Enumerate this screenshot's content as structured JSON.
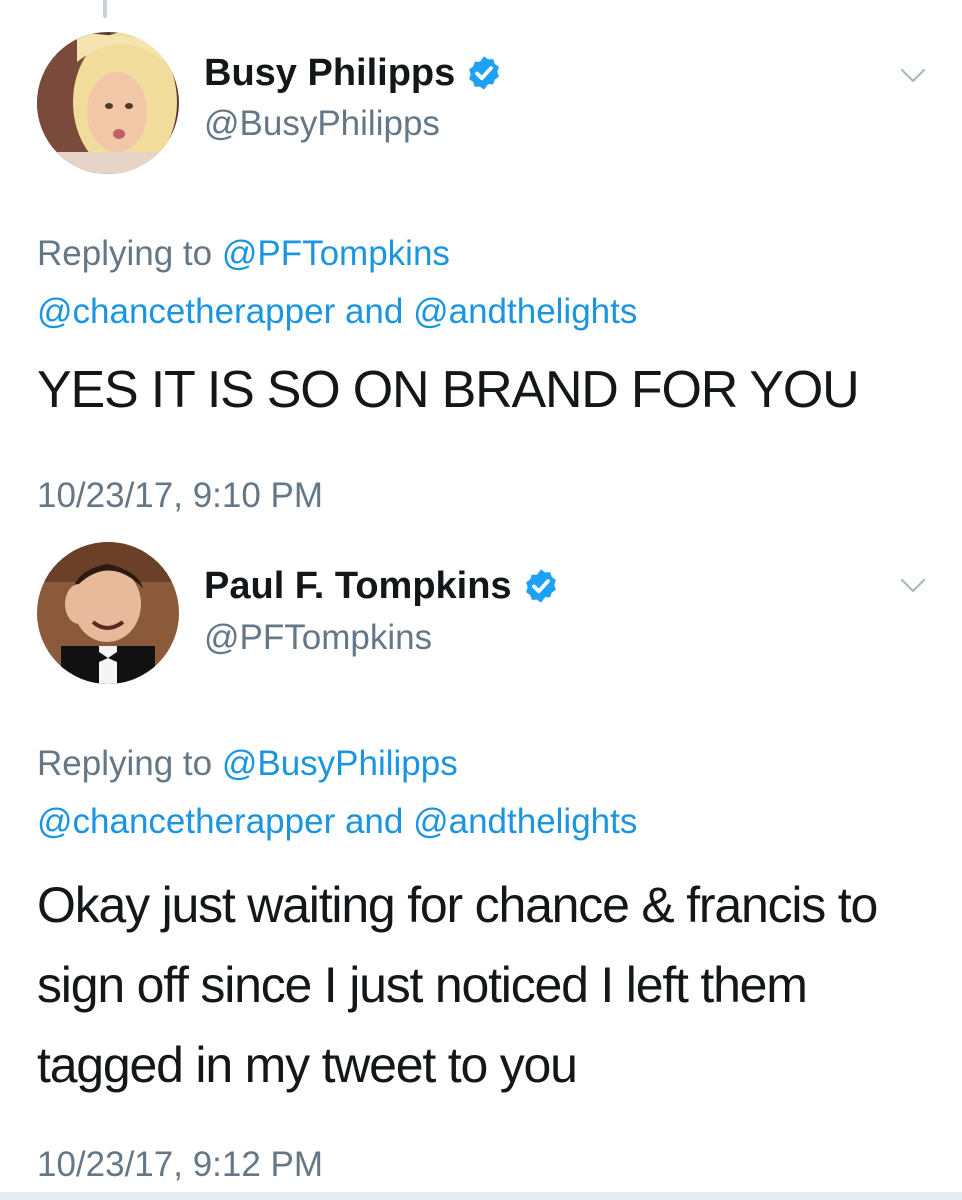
{
  "colors": {
    "name": "#14171a",
    "secondary": "#657786",
    "link": "#1b95e0",
    "verified": "#1da1f2"
  },
  "tweets": [
    {
      "display_name": "Busy Philipps",
      "handle": "@BusyPhilipps",
      "verified": true,
      "avatar_icon": "avatar-photo-busy-philipps",
      "reply_prefix": "Replying to ",
      "reply_to": "@PFTompkins",
      "reply_others_1": "@chancetherapper",
      "reply_and": " and ",
      "reply_others_2": "@andthelights",
      "text": "YES IT IS SO ON BRAND FOR YOU",
      "timestamp": "10/23/17, 9:10 PM"
    },
    {
      "display_name": "Paul F. Tompkins",
      "handle": "@PFTompkins",
      "verified": true,
      "avatar_icon": "avatar-photo-paul-f-tompkins",
      "reply_prefix": "Replying to ",
      "reply_to": "@BusyPhilipps",
      "reply_others_1": "@chancetherapper",
      "reply_and": " and ",
      "reply_others_2": "@andthelights",
      "text": "Okay just waiting for chance & francis to sign off since I just noticed I left them tagged in my tweet to you",
      "timestamp": "10/23/17, 9:12 PM"
    }
  ]
}
